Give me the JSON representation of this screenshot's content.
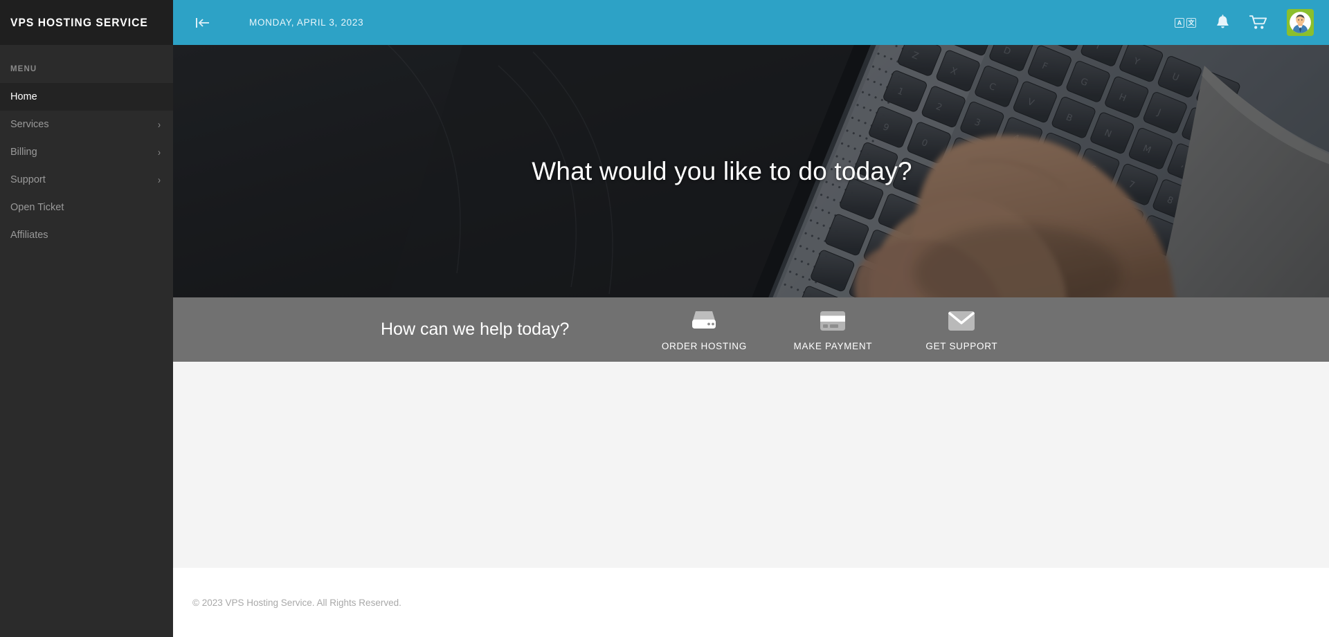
{
  "brand": {
    "name": "VPS HOSTING SERVICE"
  },
  "sidebar": {
    "menu_heading": "MENU",
    "items": [
      {
        "label": "Home",
        "has_caret": false,
        "active": true,
        "caret": "›"
      },
      {
        "label": "Services",
        "has_caret": true,
        "active": false,
        "caret": "›"
      },
      {
        "label": "Billing",
        "has_caret": true,
        "active": false,
        "caret": "›"
      },
      {
        "label": "Support",
        "has_caret": true,
        "active": false,
        "caret": "›"
      },
      {
        "label": "Open Ticket",
        "has_caret": false,
        "active": false,
        "caret": "›"
      },
      {
        "label": "Affiliates",
        "has_caret": false,
        "active": false,
        "caret": "›"
      }
    ]
  },
  "topbar": {
    "collapse_icon": "collapse-sidebar-icon",
    "date": "MONDAY, APRIL 3, 2023",
    "language_icon": {
      "name": "translate-icon",
      "latin": "A",
      "cjk": "文"
    },
    "notifications_icon": "bell-icon",
    "cart_icon": "shopping-cart-icon",
    "avatar": "user-avatar"
  },
  "hero": {
    "title": "What would you like to do today?",
    "background": "laptop-keyboard-hand-photo"
  },
  "actionbar": {
    "help_text": "How can we help today?",
    "actions": [
      {
        "label": "ORDER HOSTING",
        "icon": "server-icon"
      },
      {
        "label": "MAKE PAYMENT",
        "icon": "credit-card-icon"
      },
      {
        "label": "GET SUPPORT",
        "icon": "envelope-icon"
      }
    ]
  },
  "footer": {
    "copyright": "© 2023 VPS Hosting Service. All Rights Reserved."
  },
  "colors": {
    "accent": "#2da2c6",
    "sidebar": "#2b2b2b",
    "sidebar_dark": "#1f1f1f",
    "actionbar": "#717171",
    "content": "#f4f4f4",
    "avatar_frame": "#8bbf2d"
  }
}
